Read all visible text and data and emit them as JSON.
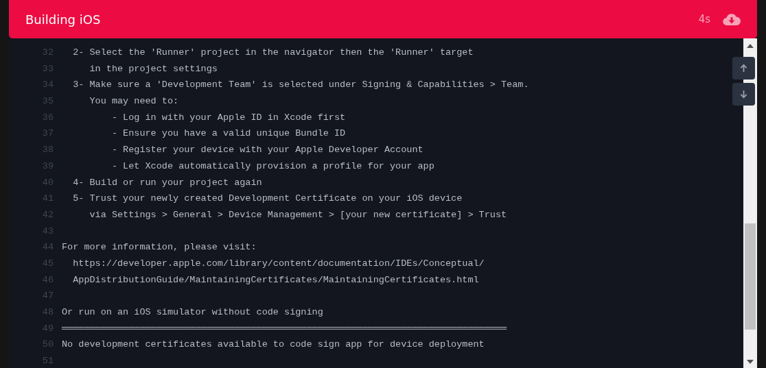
{
  "header": {
    "title": "Building iOS",
    "elapsed": "4s"
  },
  "log_lines": [
    {
      "number": "32",
      "text": "  2- Select the 'Runner' project in the navigator then the 'Runner' target"
    },
    {
      "number": "33",
      "text": "     in the project settings"
    },
    {
      "number": "34",
      "text": "  3- Make sure a 'Development Team' is selected under Signing & Capabilities > Team."
    },
    {
      "number": "35",
      "text": "     You may need to:"
    },
    {
      "number": "36",
      "text": "         - Log in with your Apple ID in Xcode first"
    },
    {
      "number": "37",
      "text": "         - Ensure you have a valid unique Bundle ID"
    },
    {
      "number": "38",
      "text": "         - Register your device with your Apple Developer Account"
    },
    {
      "number": "39",
      "text": "         - Let Xcode automatically provision a profile for your app"
    },
    {
      "number": "40",
      "text": "  4- Build or run your project again"
    },
    {
      "number": "41",
      "text": "  5- Trust your newly created Development Certificate on your iOS device"
    },
    {
      "number": "42",
      "text": "     via Settings > General > Device Management > [your new certificate] > Trust"
    },
    {
      "number": "43"
    },
    {
      "number": "44",
      "text": "For more information, please visit:"
    },
    {
      "number": "45",
      "text": "  https://developer.apple.com/library/content/documentation/IDEs/Conceptual/"
    },
    {
      "number": "46",
      "text": "  AppDistributionGuide/MaintainingCertificates/MaintainingCertificates.html"
    },
    {
      "number": "47"
    },
    {
      "number": "48",
      "text": "Or run on an iOS simulator without code signing"
    },
    {
      "number": "49",
      "text": "════════════════════════════════════════════════════════════════════════════════"
    },
    {
      "number": "50",
      "text": "No development certificates available to code sign app for device deployment"
    },
    {
      "number": "51"
    }
  ]
}
